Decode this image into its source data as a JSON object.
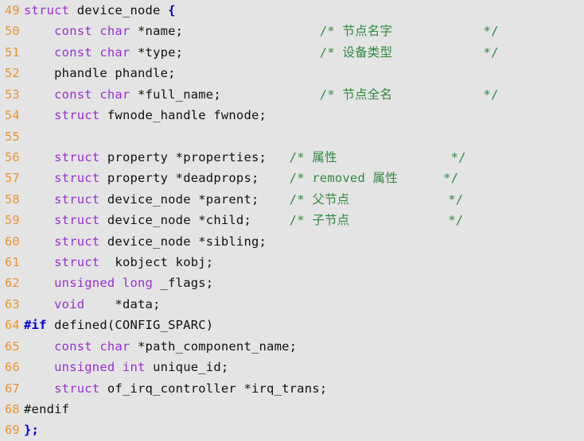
{
  "editor": {
    "language": "C",
    "background_color": "#e4e4e4",
    "gutter_color": "#e8922e",
    "keyword_color": "#9a2fd0",
    "comment_color": "#2f8a3f",
    "preprocessor_color": "#0000dd",
    "text_color": "#111111",
    "first_line_number": 49,
    "last_line_number": 69
  },
  "lines": [
    {
      "number": "49",
      "segments": [
        {
          "t": "struct",
          "c": "kw"
        },
        {
          "t": " device_node ",
          "c": "plain"
        },
        {
          "t": "{",
          "c": "brace"
        }
      ]
    },
    {
      "number": "50",
      "segments": [
        {
          "t": "    ",
          "c": "plain"
        },
        {
          "t": "const char",
          "c": "kw"
        },
        {
          "t": " *name;",
          "c": "plain"
        },
        {
          "t": "                  ",
          "c": "plain"
        },
        {
          "t": "/* 节点名字            */",
          "c": "cmt"
        }
      ]
    },
    {
      "number": "51",
      "segments": [
        {
          "t": "    ",
          "c": "plain"
        },
        {
          "t": "const char",
          "c": "kw"
        },
        {
          "t": " *type;",
          "c": "plain"
        },
        {
          "t": "                  ",
          "c": "plain"
        },
        {
          "t": "/* 设备类型            */",
          "c": "cmt"
        }
      ]
    },
    {
      "number": "52",
      "segments": [
        {
          "t": "    phandle phandle;",
          "c": "plain"
        }
      ]
    },
    {
      "number": "53",
      "segments": [
        {
          "t": "    ",
          "c": "plain"
        },
        {
          "t": "const char",
          "c": "kw"
        },
        {
          "t": " *full_name;",
          "c": "plain"
        },
        {
          "t": "             ",
          "c": "plain"
        },
        {
          "t": "/* 节点全名            */",
          "c": "cmt"
        }
      ]
    },
    {
      "number": "54",
      "segments": [
        {
          "t": "    ",
          "c": "plain"
        },
        {
          "t": "struct",
          "c": "kw"
        },
        {
          "t": " fwnode_handle fwnode;",
          "c": "plain"
        }
      ]
    },
    {
      "number": "55",
      "segments": [
        {
          "t": "",
          "c": "plain"
        }
      ]
    },
    {
      "number": "56",
      "segments": [
        {
          "t": "    ",
          "c": "plain"
        },
        {
          "t": "struct",
          "c": "kw"
        },
        {
          "t": " property *properties;",
          "c": "plain"
        },
        {
          "t": "   ",
          "c": "plain"
        },
        {
          "t": "/* 属性               */",
          "c": "cmt"
        }
      ]
    },
    {
      "number": "57",
      "segments": [
        {
          "t": "    ",
          "c": "plain"
        },
        {
          "t": "struct",
          "c": "kw"
        },
        {
          "t": " property *deadprops;",
          "c": "plain"
        },
        {
          "t": "    ",
          "c": "plain"
        },
        {
          "t": "/* removed 属性      */",
          "c": "cmt"
        }
      ]
    },
    {
      "number": "58",
      "segments": [
        {
          "t": "    ",
          "c": "plain"
        },
        {
          "t": "struct",
          "c": "kw"
        },
        {
          "t": " device_node *parent;",
          "c": "plain"
        },
        {
          "t": "    ",
          "c": "plain"
        },
        {
          "t": "/* 父节点             */",
          "c": "cmt"
        }
      ]
    },
    {
      "number": "59",
      "segments": [
        {
          "t": "    ",
          "c": "plain"
        },
        {
          "t": "struct",
          "c": "kw"
        },
        {
          "t": " device_node *child;",
          "c": "plain"
        },
        {
          "t": "     ",
          "c": "plain"
        },
        {
          "t": "/* 子节点             */",
          "c": "cmt"
        }
      ]
    },
    {
      "number": "60",
      "segments": [
        {
          "t": "    ",
          "c": "plain"
        },
        {
          "t": "struct",
          "c": "kw"
        },
        {
          "t": " device_node *sibling;",
          "c": "plain"
        }
      ]
    },
    {
      "number": "61",
      "segments": [
        {
          "t": "    ",
          "c": "plain"
        },
        {
          "t": "struct",
          "c": "kw"
        },
        {
          "t": "  kobject kobj;",
          "c": "plain"
        }
      ]
    },
    {
      "number": "62",
      "segments": [
        {
          "t": "    ",
          "c": "plain"
        },
        {
          "t": "unsigned long",
          "c": "kw"
        },
        {
          "t": " _flags;",
          "c": "plain"
        }
      ]
    },
    {
      "number": "63",
      "segments": [
        {
          "t": "    ",
          "c": "plain"
        },
        {
          "t": "void",
          "c": "kw"
        },
        {
          "t": "    *data;",
          "c": "plain"
        }
      ]
    },
    {
      "number": "64",
      "segments": [
        {
          "t": "#if",
          "c": "pp"
        },
        {
          "t": " defined(CONFIG_SPARC)",
          "c": "plain"
        }
      ]
    },
    {
      "number": "65",
      "segments": [
        {
          "t": "    ",
          "c": "plain"
        },
        {
          "t": "const char",
          "c": "kw"
        },
        {
          "t": " *path_component_name;",
          "c": "plain"
        }
      ]
    },
    {
      "number": "66",
      "segments": [
        {
          "t": "    ",
          "c": "plain"
        },
        {
          "t": "unsigned int",
          "c": "kw"
        },
        {
          "t": " unique_id;",
          "c": "plain"
        }
      ]
    },
    {
      "number": "67",
      "segments": [
        {
          "t": "    ",
          "c": "plain"
        },
        {
          "t": "struct",
          "c": "kw"
        },
        {
          "t": " of_irq_controller *irq_trans;",
          "c": "plain"
        }
      ]
    },
    {
      "number": "68",
      "segments": [
        {
          "t": "#endif",
          "c": "plain"
        }
      ]
    },
    {
      "number": "69",
      "segments": [
        {
          "t": "};",
          "c": "brace"
        }
      ]
    }
  ]
}
